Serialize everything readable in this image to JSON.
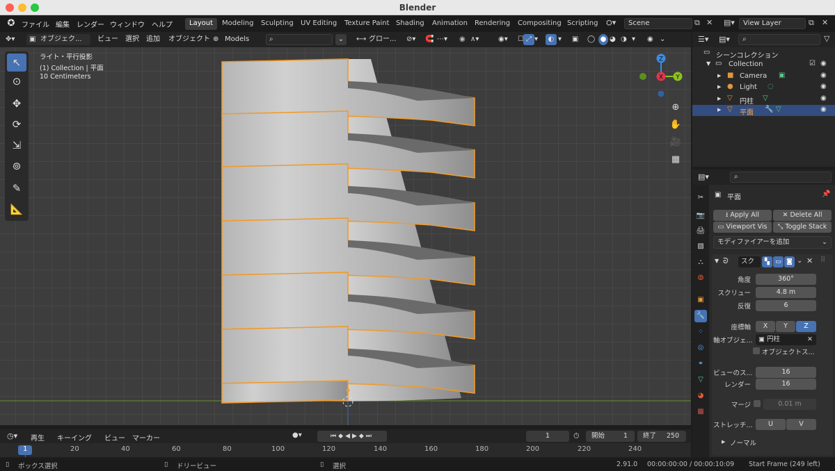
{
  "window": {
    "title": "Blender"
  },
  "topbar": {
    "menus": [
      "ファイル",
      "編集",
      "レンダー",
      "ウィンドウ",
      "ヘルプ"
    ],
    "workspaces": [
      "Layout",
      "Modeling",
      "Sculpting",
      "UV Editing",
      "Texture Paint",
      "Shading",
      "Animation",
      "Rendering",
      "Compositing",
      "Scripting"
    ],
    "active_workspace": "Layout",
    "scene": "Scene",
    "view_layer": "View Layer"
  },
  "viewport_header": {
    "mode": "オブジェク...",
    "menus": [
      "ビュー",
      "選択",
      "追加",
      "オブジェクト"
    ],
    "collection": "Models",
    "transform_orientation": "グロー..."
  },
  "viewport": {
    "overlay_lines": [
      "ライト・平行投影",
      "(1) Collection | 平面",
      "10 Centimeters"
    ],
    "gizmo_axes": [
      "X",
      "Y",
      "Z"
    ]
  },
  "outliner": {
    "root": "シーンコレクション",
    "collection": "Collection",
    "items": [
      {
        "name": "Camera",
        "icon": "camera-icon"
      },
      {
        "name": "Light",
        "icon": "light-icon"
      },
      {
        "name": "円柱",
        "icon": "mesh-icon"
      },
      {
        "name": "平面",
        "icon": "mesh-icon",
        "selected": true
      }
    ]
  },
  "properties": {
    "object_name": "平面",
    "apply_all": "Apply All",
    "delete_all": "Delete All",
    "viewport_vis": "Viewport Vis",
    "toggle_stack": "Toggle Stack",
    "add_modifier": "モディファイアーを追加",
    "modifier_name": "スク",
    "fields": {
      "angle_label": "角度",
      "angle_value": "360°",
      "screw_label": "スクリュー",
      "screw_value": "4.8 m",
      "iterations_label": "反復",
      "iterations_value": "6",
      "axis_label": "座標軸",
      "axis_x": "X",
      "axis_y": "Y",
      "axis_z": "Z",
      "axis_selected": "Z",
      "axis_object_label": "軸オブジェ...",
      "axis_object_value": "円柱",
      "object_screw_label": "オブジェクトス...",
      "viewport_steps_label": "ビューのス...",
      "viewport_steps_value": "16",
      "render_steps_label": "レンダー",
      "render_steps_value": "16",
      "merge_label": "マージ",
      "merge_value": "0.01 m",
      "stretch_label": "ストレッチ...",
      "stretch_u": "U",
      "stretch_v": "V",
      "normals_label": "ノーマル"
    }
  },
  "timeline": {
    "menus": [
      "再生",
      "キーイング",
      "ビュー",
      "マーカー"
    ],
    "current_frame": "1",
    "start_label": "開始",
    "start_value": "1",
    "end_label": "終了",
    "end_value": "250",
    "ticks": [
      "1",
      "20",
      "40",
      "60",
      "80",
      "100",
      "120",
      "140",
      "160",
      "180",
      "200",
      "220",
      "240"
    ]
  },
  "status": {
    "box_select": "ボックス選択",
    "dolly": "ドリービュー",
    "select": "選択",
    "version": "2.91.0",
    "time": "00:00:00:00 / 00:00:10:09",
    "start_frame": "Start Frame (249 left)"
  },
  "colors": {
    "accent": "#4772b3",
    "selection": "#f09a2a",
    "x_axis": "#e0364a",
    "y_axis": "#8bc31f",
    "z_axis": "#3b8de6"
  }
}
